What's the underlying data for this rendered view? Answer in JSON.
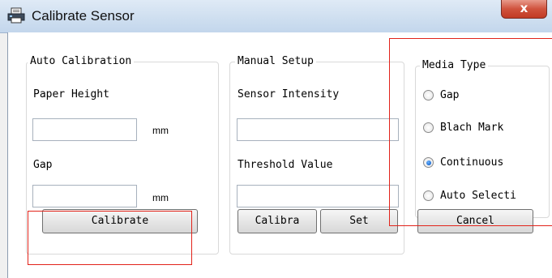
{
  "window": {
    "title": "Calibrate Sensor",
    "close_label": "x"
  },
  "auto_calibration": {
    "legend": "Auto Calibration",
    "paper_height_label": "Paper Height",
    "paper_height_value": "",
    "paper_height_unit": "mm",
    "gap_label": "Gap",
    "gap_value": "",
    "gap_unit": "mm",
    "calibrate_button": "Calibrate"
  },
  "manual_setup": {
    "legend": "Manual Setup",
    "sensor_intensity_label": "Sensor Intensity",
    "sensor_intensity_value": "",
    "threshold_label": "Threshold Value",
    "threshold_value": "",
    "calibrate_button": "Calibra",
    "set_button": "Set"
  },
  "media_type": {
    "legend": "Media Type",
    "options": [
      {
        "label": "Gap",
        "selected": false
      },
      {
        "label": "Blach Mark",
        "selected": false
      },
      {
        "label": "Continuous",
        "selected": true
      },
      {
        "label": "Auto Selecti",
        "selected": false
      }
    ]
  },
  "cancel_button": "Cancel",
  "colors": {
    "highlight": "#e2231a",
    "titlebar": "#cfdff0",
    "close": "#c13a24"
  }
}
